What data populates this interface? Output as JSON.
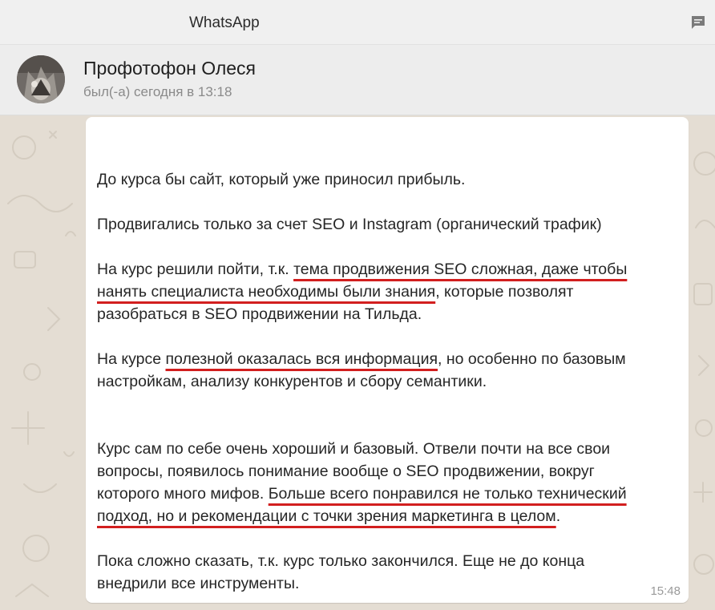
{
  "window": {
    "title": "WhatsApp"
  },
  "contact": {
    "name": "Профотофон Олеся",
    "status": "был(-а) сегодня в 13:18"
  },
  "message": {
    "p1": "До курса бы сайт, который уже приносил прибыль.",
    "p2": "Продвигались только за счет SEO и Instagram (органический трафик)",
    "p3": {
      "a": "На курс решили пойти, т.к. ",
      "b": "тема продвижения SEO сложная, даже чтобы",
      "c": "нанять специалиста необходимы были знания",
      "d": ", которые позволят",
      "e": "разобраться в SEO продвижении на Тильда."
    },
    "p4": {
      "a": "На курсе ",
      "b": "полезной оказалась вся информация",
      "c": ", но особенно по базовым",
      "d": "настройкам, анализу конкурентов и сбору семантики."
    },
    "p5": {
      "a": "Курс сам по себе очень хороший и базовый. Отвели почти на все свои",
      "b": "вопросы, появилось понимание вообще о SEO продвижении, вокруг",
      "c": "которого много мифов. ",
      "d": "Больше всего понравился не только технический",
      "e": "подход, но и рекомендации с точки зрения маркетинга в целом",
      "f": "."
    },
    "p6": {
      "a": "Пока сложно сказать, т.к. курс только закончился. Еще не до конца",
      "b": "внедрили все инструменты."
    },
    "time": "15:48"
  },
  "colors": {
    "highlight_underline": "#d21f1f",
    "titlebar_bg": "#f0f0f0",
    "header_bg": "#ededed",
    "chat_bg": "#e4ddd3",
    "bubble_bg": "#ffffff"
  },
  "icons": {
    "window_action": "chat-bubble-icon",
    "avatar": "contact-photo"
  }
}
